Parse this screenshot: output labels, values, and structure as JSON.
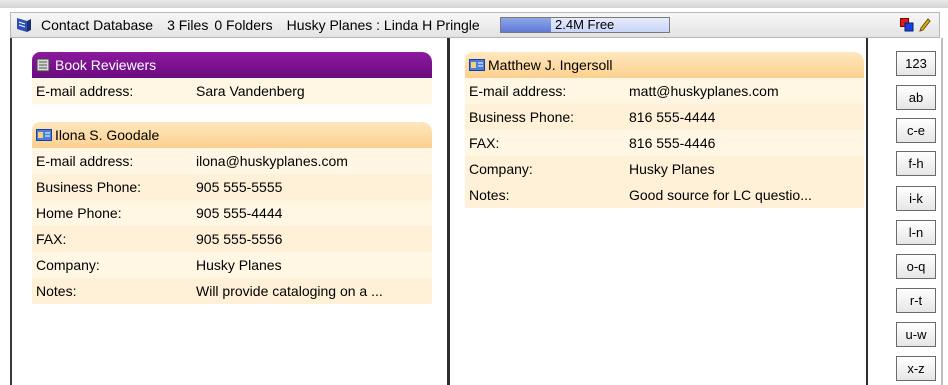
{
  "titlebar": {
    "db_name": "Contact Database",
    "files": "3 Files",
    "folders": "0 Folders",
    "user": "Husky Planes : Linda H Pringle",
    "free_space": "2.4M Free",
    "free_fraction": 0.3
  },
  "cards": {
    "book_reviewers": {
      "title": "Book Reviewers",
      "rows": [
        {
          "label": "E-mail address:",
          "value": "Sara Vandenberg"
        }
      ]
    },
    "ilona": {
      "title": "Ilona S. Goodale",
      "rows": [
        {
          "label": "E-mail address:",
          "value": "ilona@huskyplanes.com"
        },
        {
          "label": "Business Phone:",
          "value": "905 555-5555"
        },
        {
          "label": "Home Phone:",
          "value": "905 555-4444"
        },
        {
          "label": "FAX:",
          "value": "905 555-5556"
        },
        {
          "label": "Company:",
          "value": "Husky Planes"
        },
        {
          "label": "Notes:",
          "value": "Will provide cataloging on a ..."
        }
      ]
    },
    "matthew": {
      "title": "Matthew J. Ingersoll",
      "rows": [
        {
          "label": "E-mail address:",
          "value": "matt@huskyplanes.com"
        },
        {
          "label": "Business Phone:",
          "value": "816 555-4444"
        },
        {
          "label": "FAX:",
          "value": "816 555-4446"
        },
        {
          "label": "Company:",
          "value": "Husky Planes"
        },
        {
          "label": "Notes:",
          "value": "Good source for LC questio..."
        }
      ]
    }
  },
  "alphabet_tabs": [
    "123",
    "ab",
    "c-e",
    "f-h",
    "i-k",
    "l-n",
    "o-q",
    "r-t",
    "u-w",
    "x-z"
  ],
  "colors": {
    "folder_header": "#7a1290",
    "contact_header": "#fbd890",
    "card_body": "#fff6e4"
  },
  "icons": {
    "app": "contact-database-icon",
    "folder": "folder-card-icon",
    "contact": "contact-card-icon",
    "toolbar_a": "pages-icon",
    "toolbar_b": "pencil-icon"
  }
}
